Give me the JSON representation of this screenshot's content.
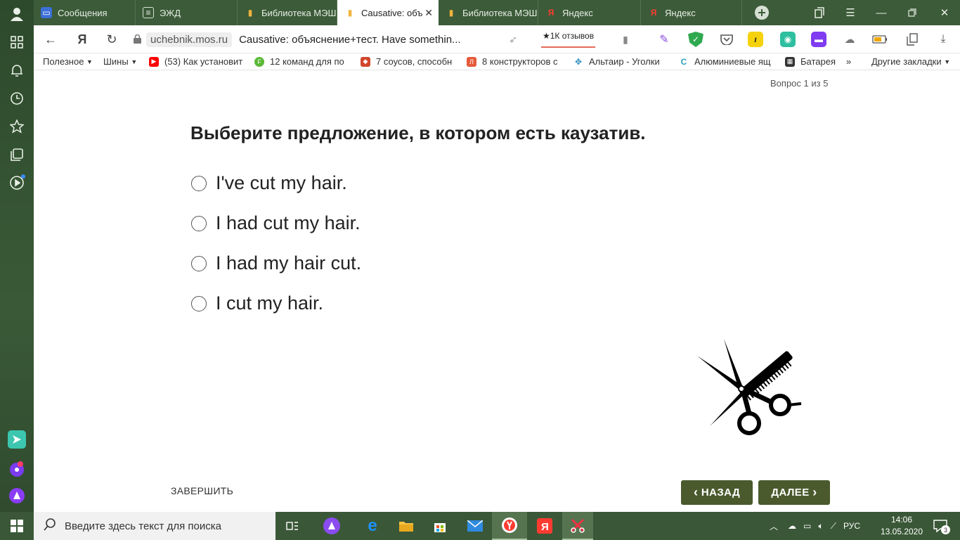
{
  "tabs": [
    {
      "label": "Сообщения",
      "icon": "chat-icon"
    },
    {
      "label": "ЭЖД",
      "icon": "doc-icon"
    },
    {
      "label": "Библиотека МЭШ",
      "icon": "book-icon"
    },
    {
      "label": "Causative: объ",
      "icon": "book-icon",
      "active": true
    },
    {
      "label": "Библиотека МЭШ",
      "icon": "book-icon"
    },
    {
      "label": "Яндекс",
      "icon": "yandex-icon"
    },
    {
      "label": "Яндекс",
      "icon": "yandex-icon"
    }
  ],
  "address": {
    "domain": "uchebnik.mos.ru",
    "title": "Causative: объяснение+тест. Have somethin...",
    "reviews": "★1К отзывов"
  },
  "bookmarks": [
    {
      "label": "Полезное",
      "dropdown": true
    },
    {
      "label": "Шины",
      "dropdown": true
    },
    {
      "label": "(53) Как установит"
    },
    {
      "label": "12 команд для по"
    },
    {
      "label": "7 соусов, способн"
    },
    {
      "label": "8 конструкторов с"
    },
    {
      "label": "Альтаир - Уголки"
    },
    {
      "label": "Алюминиевые ящ"
    },
    {
      "label": "Батарея"
    }
  ],
  "bookmarks_more": "Другие закладки",
  "quiz": {
    "counter": "Вопрос 1 из 5",
    "question": "Выберите предложение, в котором есть каузатив.",
    "options": [
      "I've cut my hair.",
      "I had cut my hair.",
      "I had my hair cut.",
      "I cut my hair."
    ],
    "finish": "ЗАВЕРШИТЬ",
    "back": "НАЗАД",
    "next": "ДАЛЕЕ"
  },
  "taskbar": {
    "search_placeholder": "Введите здесь текст для поиска",
    "lang": "РУС",
    "time": "14:06",
    "date": "13.05.2020",
    "notifications": "3"
  },
  "colors": {
    "theme_green": "#3c5b39",
    "button": "#4a5a2d"
  }
}
